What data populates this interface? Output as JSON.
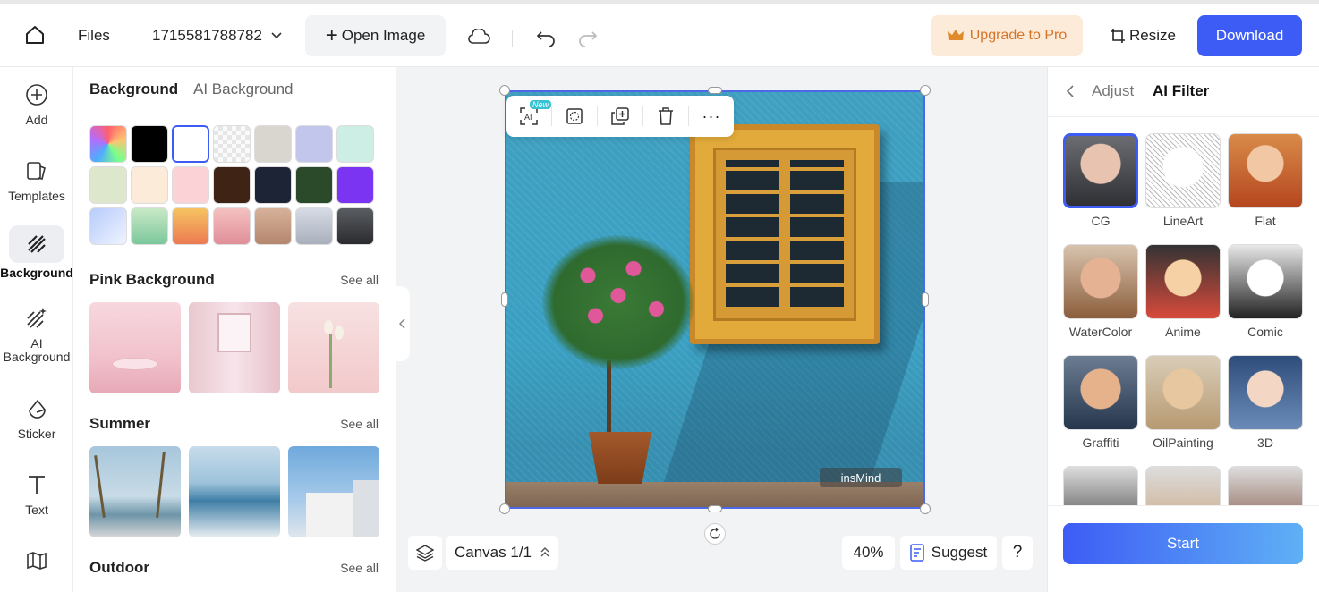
{
  "topbar": {
    "files_label": "Files",
    "project_name": "1715581788782",
    "open_image_label": "Open Image",
    "upgrade_label": "Upgrade to Pro",
    "resize_label": "Resize",
    "download_label": "Download"
  },
  "leftnav": {
    "items": [
      {
        "label": "Add",
        "icon": "plus-circle-icon"
      },
      {
        "label": "Templates",
        "icon": "templates-icon"
      },
      {
        "label": "Background",
        "icon": "background-icon"
      },
      {
        "label": "AI Background",
        "icon": "ai-background-icon"
      },
      {
        "label": "Sticker",
        "icon": "sticker-icon"
      },
      {
        "label": "Text",
        "icon": "text-icon"
      },
      {
        "label": "",
        "icon": "map-icon"
      }
    ]
  },
  "panel": {
    "tab_active": "Background",
    "tab_inactive": "AI Background",
    "colors": [
      "#f5f5f5",
      "#000000",
      "#ffffff",
      "#eeeeee",
      "#d9d6d0",
      "#c3c6ec",
      "#cdeee5",
      "#dde7cc",
      "#fdebd9",
      "#fbd3d6",
      "#3f2416",
      "#1d2435",
      "#2a4a2a",
      "#7a34f2",
      "#c7d8fb",
      "#a9dcae",
      "#f4a355",
      "#f2b6b6",
      "#caa58c",
      "#c9ced9",
      "#3a3c40"
    ],
    "sections": [
      {
        "title": "Pink Background",
        "see_all": "See all"
      },
      {
        "title": "Summer",
        "see_all": "See all"
      },
      {
        "title": "Outdoor",
        "see_all": "See all"
      }
    ]
  },
  "canvas": {
    "new_badge": "New",
    "canvas_label": "Canvas 1/1",
    "zoom": "40%",
    "suggest_label": "Suggest",
    "help_label": "?",
    "watermark": "insMind"
  },
  "right_panel": {
    "tab_inactive": "Adjust",
    "tab_active": "AI Filter",
    "filters": [
      "CG",
      "LineArt",
      "Flat",
      "WaterColor",
      "Anime",
      "Comic",
      "Graffiti",
      "OilPainting",
      "3D"
    ],
    "start_label": "Start"
  }
}
